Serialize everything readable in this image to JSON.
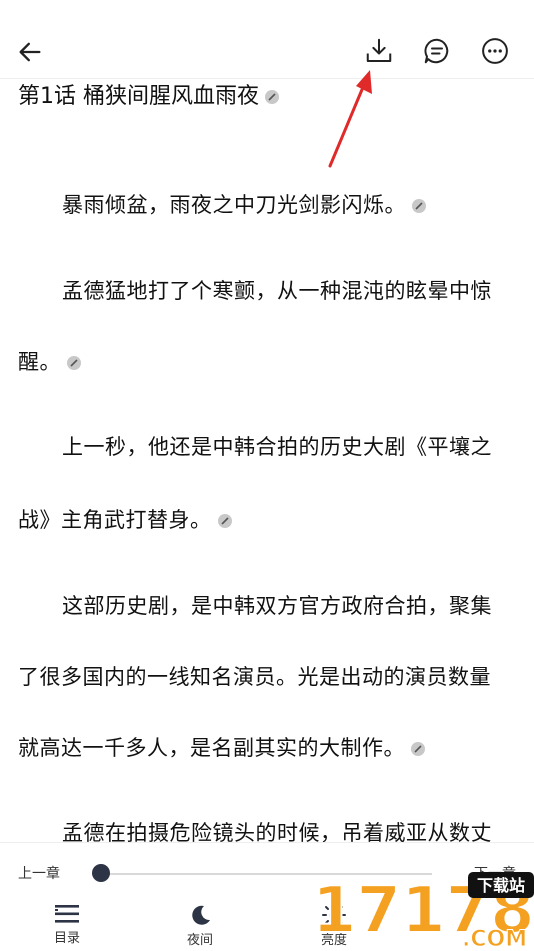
{
  "header": {
    "icons": [
      "back-arrow-icon",
      "download-icon",
      "comment-icon",
      "more-icon"
    ]
  },
  "content": {
    "chapter_title": "第1话 桶狭间腥风血雨夜",
    "lines": [
      "暴雨倾盆，雨夜之中刀光剑影闪烁。",
      "孟德猛地打了个寒颤，从一种混沌的眩晕中惊",
      "醒。",
      "上一秒，他还是中韩合拍的历史大剧《平壤之",
      "战》主角武打替身。",
      "这部历史剧，是中韩双方官方政府合拍，聚集",
      "了很多国内的一线知名演员。光是出动的演员数量",
      "就高达一千多人，是名副其实的大制作。",
      "孟德在拍摄危险镜头的时候，吊着威亚从数丈"
    ]
  },
  "bottom": {
    "prev_label": "上一章",
    "next_label": "下一章",
    "progress": 0.0,
    "tabs": [
      {
        "label": "目录",
        "icon": "menu-list-icon"
      },
      {
        "label": "夜间",
        "icon": "moon-icon"
      },
      {
        "label": "亮度",
        "icon": "brightness-icon"
      }
    ]
  },
  "watermark": {
    "text_main": "17178",
    "text_badge": "下载站",
    "text_domain": ".COM"
  },
  "colors": {
    "accent_arrow": "#e02a2a",
    "slider_thumb": "#2c3445",
    "watermark_orange": "#f4a020"
  }
}
